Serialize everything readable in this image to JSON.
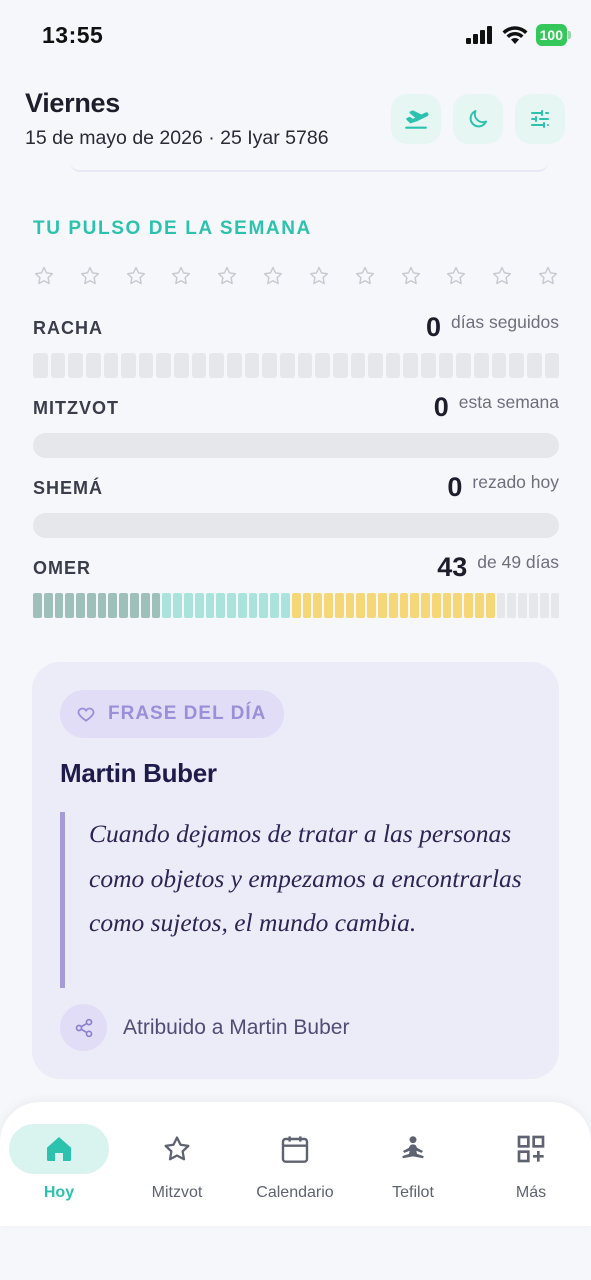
{
  "status_bar": {
    "time": "13:55",
    "battery": "100",
    "icons": [
      "signal-icon",
      "wifi-icon",
      "battery-icon"
    ]
  },
  "header": {
    "day": "Viernes",
    "date": "15 de mayo de 2026 · 25 Iyar 5786",
    "actions": [
      "plane-icon",
      "moon-icon",
      "sliders-icon"
    ]
  },
  "pulse": {
    "title": "TU PULSO DE LA SEMANA",
    "stars_count": 12,
    "metrics": {
      "racha": {
        "label": "RACHA",
        "value": "0",
        "unit": "días seguidos",
        "segments": 30,
        "filled": 0
      },
      "mitzvot": {
        "label": "MITZVOT",
        "value": "0",
        "unit": "esta semana",
        "progress": 0
      },
      "shema": {
        "label": "SHEMÁ",
        "value": "0",
        "unit": "rezado hoy",
        "progress": 0
      },
      "omer": {
        "label": "OMER",
        "value": "43",
        "unit": "de 49 días",
        "total": 49,
        "filled": 43
      }
    }
  },
  "quote": {
    "badge": "FRASE DEL DÍA",
    "author": "Martin Buber",
    "text": "Cuando dejamos de tratar a las personas como objetos y empezamos a encontrarlas como sujetos, el mundo cambia.",
    "attribution": "Atribuido a Martin Buber"
  },
  "nav": {
    "items": [
      {
        "label": "Hoy",
        "icon": "home-icon",
        "active": true
      },
      {
        "label": "Mitzvot",
        "icon": "star-icon",
        "active": false
      },
      {
        "label": "Calendario",
        "icon": "calendar-icon",
        "active": false
      },
      {
        "label": "Tefilot",
        "icon": "prayer-icon",
        "active": false
      },
      {
        "label": "Más",
        "icon": "grid-plus-icon",
        "active": false
      }
    ]
  },
  "colors": {
    "accent": "#2cc2ad",
    "omer_week1": "#9fbfbb",
    "omer_week2": "#a9e3dc",
    "omer_week3": "#f6d778",
    "empty": "#e6e7ea",
    "quote_accent": "#a79ad9"
  }
}
